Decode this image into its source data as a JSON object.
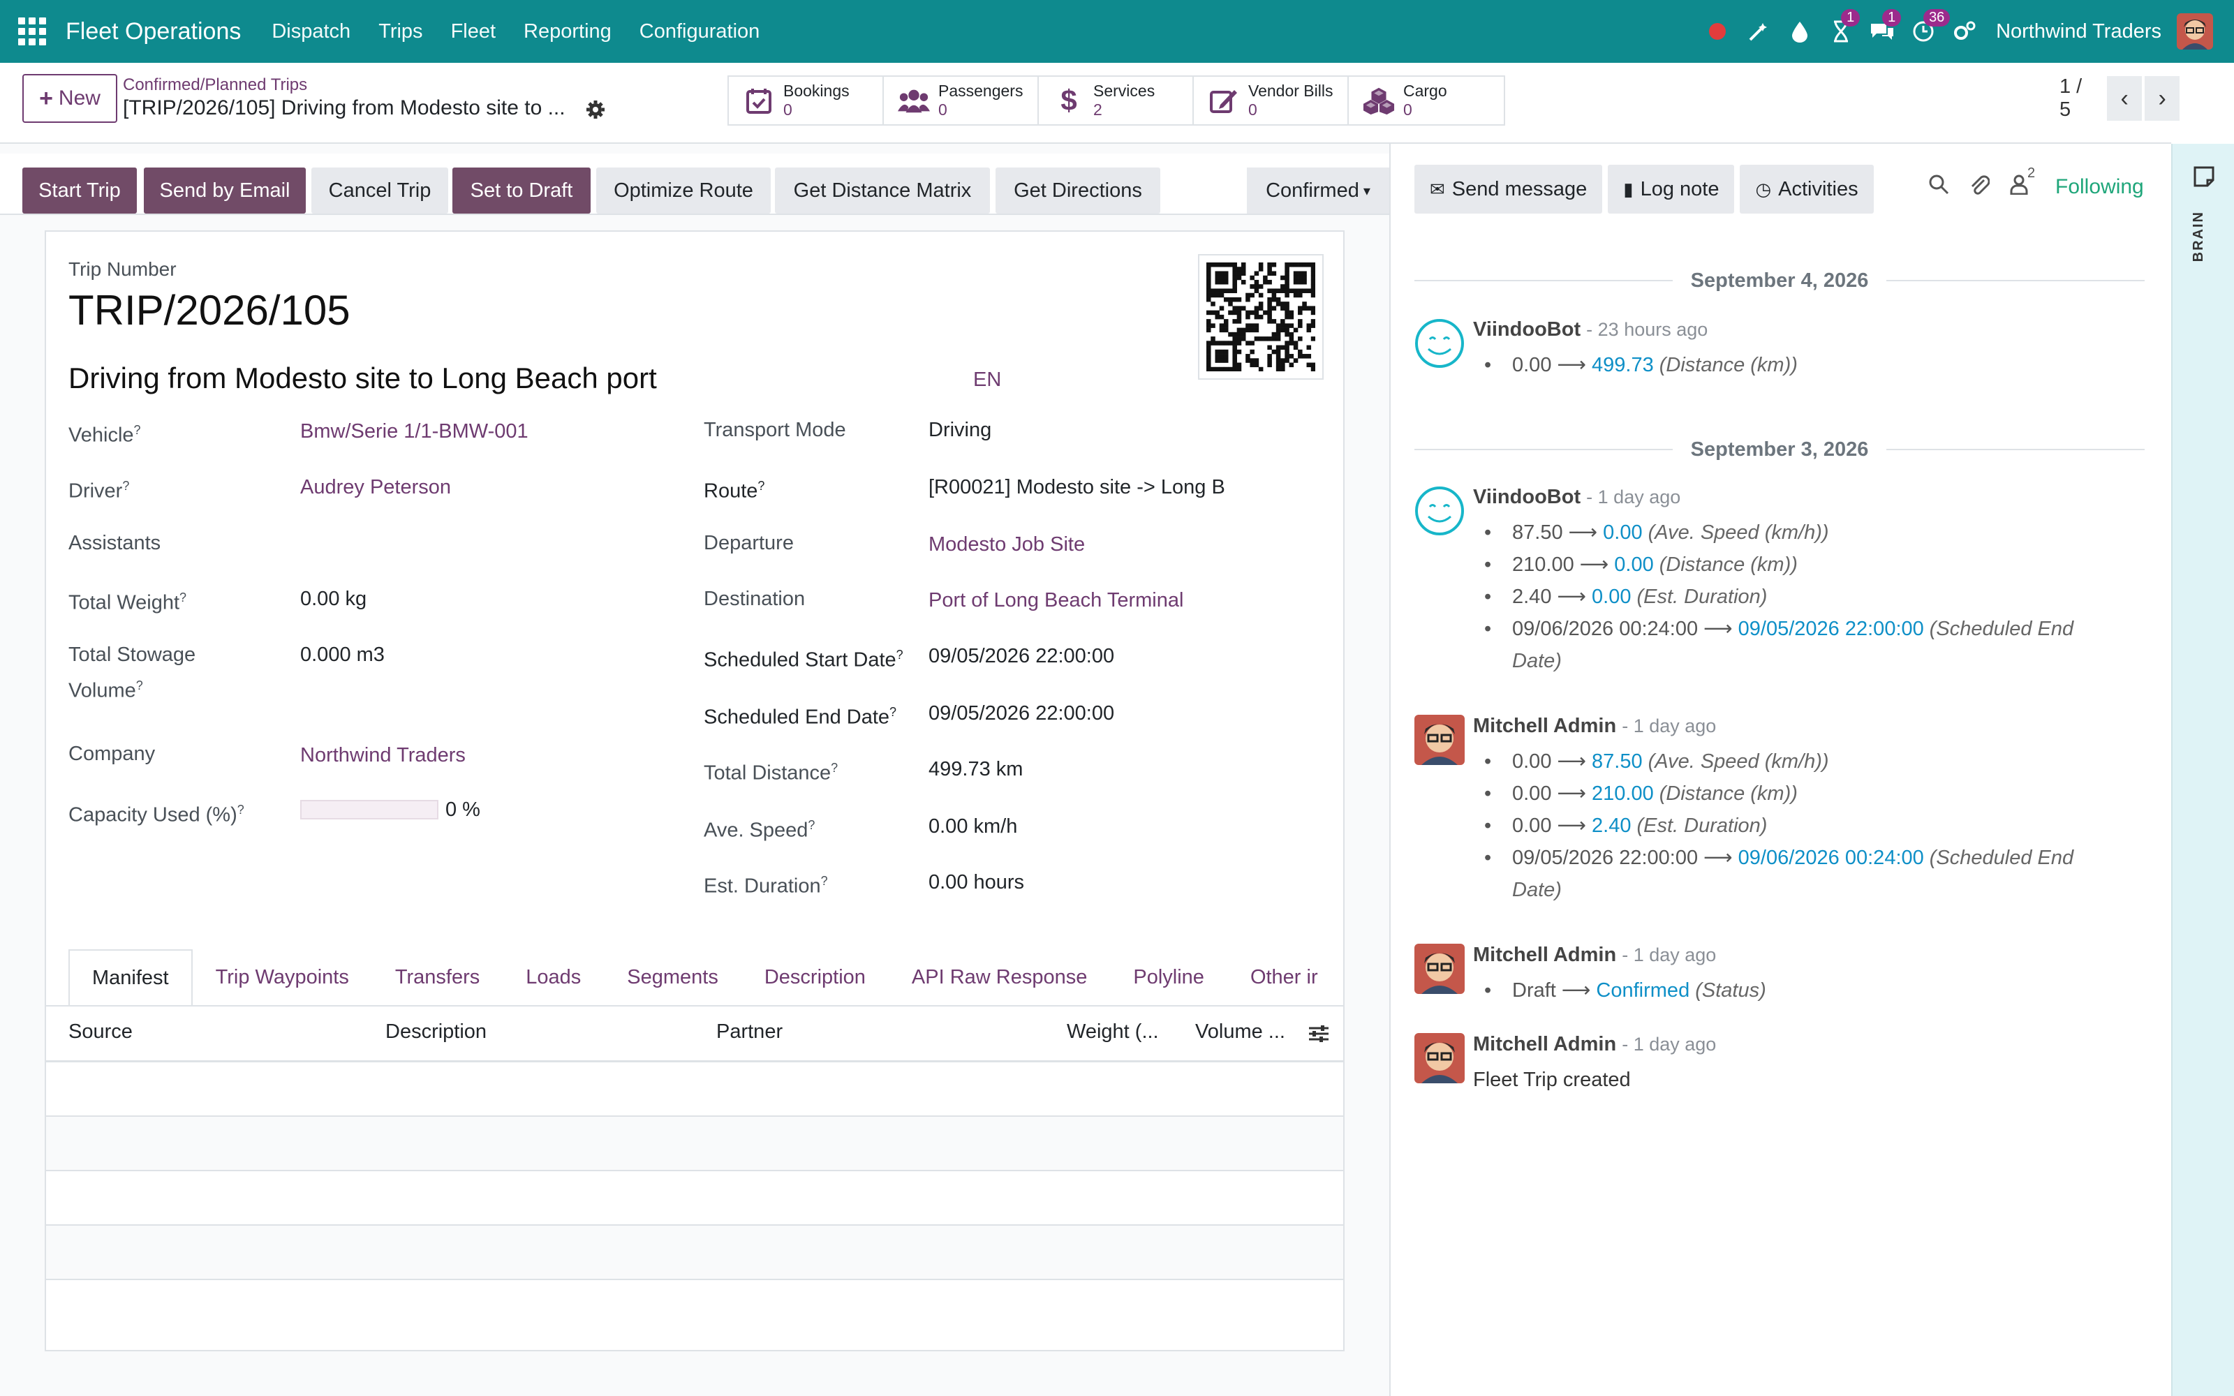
{
  "navbar": {
    "app_name": "Fleet Operations",
    "menu": [
      "Dispatch",
      "Trips",
      "Fleet",
      "Reporting",
      "Configuration"
    ],
    "badges": {
      "activities": "1",
      "messages": "1",
      "timer": "36"
    },
    "company": "Northwind Traders",
    "bg_color": "#0e8a8e"
  },
  "control": {
    "new_label": "New",
    "breadcrumb": "Confirmed/Planned Trips",
    "record_title": "[TRIP/2026/105] Driving from Modesto site to ...",
    "smart_buttons": [
      {
        "icon": "calendar-check-icon",
        "label": "Bookings",
        "count": "0"
      },
      {
        "icon": "users-icon",
        "label": "Passengers",
        "count": "0"
      },
      {
        "icon": "dollar-icon",
        "label": "Services",
        "count": "2"
      },
      {
        "icon": "edit-icon",
        "label": "Vendor Bills",
        "count": "0"
      },
      {
        "icon": "cubes-icon",
        "label": "Cargo",
        "count": "0"
      }
    ],
    "pager": "1 / 5"
  },
  "statusbar": {
    "buttons": [
      "Start Trip",
      "Send by Email",
      "Cancel Trip",
      "Set to Draft",
      "Optimize Route",
      "Get Distance Matrix",
      "Get Directions"
    ],
    "status": "Confirmed"
  },
  "form": {
    "trip_number_label": "Trip Number",
    "trip_number": "TRIP/2026/105",
    "trip_name": "Driving from Modesto site to Long Beach port",
    "lang": "EN",
    "left_fields": [
      {
        "label": "Vehicle",
        "help": "?",
        "value": "Bmw/Serie 1/1-BMW-001"
      },
      {
        "label": "Driver",
        "help": "?",
        "value": "Audrey Peterson"
      },
      {
        "label": "Assistants",
        "help": "",
        "value": ""
      },
      {
        "label": "Total Weight",
        "help": "?",
        "value": "0.00 kg"
      },
      {
        "label_line1": "Total Stowage",
        "label_line2": "Volume",
        "help": "?",
        "value": "0.000 m3"
      },
      {
        "label": "Company",
        "help": "",
        "value": "Northwind Traders"
      },
      {
        "label": "Capacity Used (%)",
        "help": "?",
        "value": "0 %",
        "progress": 0
      }
    ],
    "right_fields": [
      {
        "label": "Transport Mode",
        "help": "",
        "value": "Driving"
      },
      {
        "label": "Route",
        "help": "?",
        "value": "[R00021] Modesto site -> Long B"
      },
      {
        "label": "Departure",
        "help": "",
        "value": "Modesto Job Site"
      },
      {
        "label": "Destination",
        "help": "",
        "value": "Port of Long Beach Terminal"
      },
      {
        "label": "Scheduled Start Date",
        "help": "?",
        "value": "09/05/2026 22:00:00"
      },
      {
        "label": "Scheduled End Date",
        "help": "?",
        "value": "09/05/2026 22:00:00"
      },
      {
        "label": "Total Distance",
        "help": "?",
        "value": "499.73 km"
      },
      {
        "label": "Ave. Speed",
        "help": "?",
        "value": "0.00 km/h"
      },
      {
        "label": "Est. Duration",
        "help": "?",
        "value": "0.00 hours"
      }
    ],
    "tabs": [
      "Manifest",
      "Trip Waypoints",
      "Transfers",
      "Loads",
      "Segments",
      "Description",
      "API Raw Response",
      "Polyline",
      "Other ir"
    ],
    "grid_columns": [
      "Source",
      "Description",
      "Partner",
      "Weight (...",
      "Volume ..."
    ]
  },
  "chatter": {
    "send_message": "Send message",
    "log_note": "Log note",
    "activities": "Activities",
    "followers_count": "2",
    "following": "Following",
    "dates": [
      "September 4, 2026",
      "September 3, 2026"
    ],
    "messages": [
      {
        "author": "ViindooBot",
        "time": "- 23 hours ago",
        "tracks": [
          {
            "old": "0.00",
            "new": "499.73",
            "field": "(Distance (km))"
          }
        ]
      },
      {
        "author": "ViindooBot",
        "time": "- 1 day ago",
        "tracks": [
          {
            "old": "87.50",
            "new": "0.00",
            "field": "(Ave. Speed (km/h))"
          },
          {
            "old": "210.00",
            "new": "0.00",
            "field": "(Distance (km))"
          },
          {
            "old": "2.40",
            "new": "0.00",
            "field": "(Est. Duration)"
          },
          {
            "old": "09/06/2026 00:24:00",
            "new": "09/05/2026 22:00:00",
            "field": "(Scheduled End",
            "field2": "Date)"
          }
        ]
      },
      {
        "author": "Mitchell Admin",
        "time": "- 1 day ago",
        "tracks": [
          {
            "old": "0.00",
            "new": "87.50",
            "field": "(Ave. Speed (km/h))"
          },
          {
            "old": "0.00",
            "new": "210.00",
            "field": "(Distance (km))"
          },
          {
            "old": "0.00",
            "new": "2.40",
            "field": "(Est. Duration)"
          },
          {
            "old": "09/05/2026 22:00:00",
            "new": "09/06/2026 00:24:00",
            "field": "(Scheduled End",
            "field2": "Date)"
          }
        ]
      },
      {
        "author": "Mitchell Admin",
        "time": "- 1 day ago",
        "tracks": [
          {
            "old": "Draft",
            "new": "Confirmed",
            "field": "(Status)"
          }
        ]
      },
      {
        "author": "Mitchell Admin",
        "time": "- 1 day ago",
        "text": "Fleet Trip created"
      }
    ]
  },
  "brain": {
    "label": "BRAIN"
  }
}
